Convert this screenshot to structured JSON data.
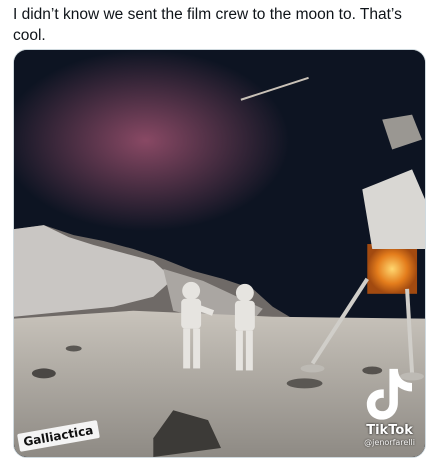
{
  "tweet": {
    "text": "I didn’t know we sent the film crew to the moon to. That’s cool."
  },
  "media": {
    "watermark": "Galliactica",
    "platform": "TikTok",
    "username": "@jenorfarelli"
  }
}
